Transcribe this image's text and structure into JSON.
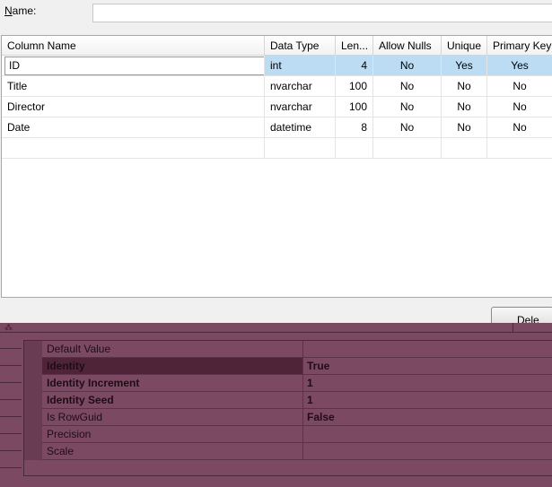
{
  "name_field": {
    "label_accel": "N",
    "label_rest": "ame:",
    "value": ""
  },
  "grid": {
    "headers": [
      "Column Name",
      "Data Type",
      "Len...",
      "Allow Nulls",
      "Unique",
      "Primary Key"
    ],
    "rows": [
      {
        "name": "ID",
        "type": "int",
        "length": "4",
        "nulls": "No",
        "unique": "Yes",
        "pk": "Yes"
      },
      {
        "name": "Title",
        "type": "nvarchar",
        "length": "100",
        "nulls": "No",
        "unique": "No",
        "pk": "No"
      },
      {
        "name": "Director",
        "type": "nvarchar",
        "length": "100",
        "nulls": "No",
        "unique": "No",
        "pk": "No"
      },
      {
        "name": "Date",
        "type": "datetime",
        "length": "8",
        "nulls": "No",
        "unique": "No",
        "pk": "No"
      }
    ]
  },
  "delete_button": {
    "label": "Dele"
  },
  "properties": {
    "sort_glyph": "⁂",
    "rows": [
      {
        "name": "Default Value",
        "value": ""
      },
      {
        "name": "Identity",
        "value": "True"
      },
      {
        "name": "Identity Increment",
        "value": "1"
      },
      {
        "name": "Identity Seed",
        "value": "1"
      },
      {
        "name": "Is RowGuid",
        "value": "False"
      },
      {
        "name": "Precision",
        "value": ""
      },
      {
        "name": "Scale",
        "value": ""
      }
    ]
  },
  "colors": {
    "selection": "#bcdcf4",
    "panel": "#7b4a62",
    "panel_selected": "#4f2438"
  }
}
